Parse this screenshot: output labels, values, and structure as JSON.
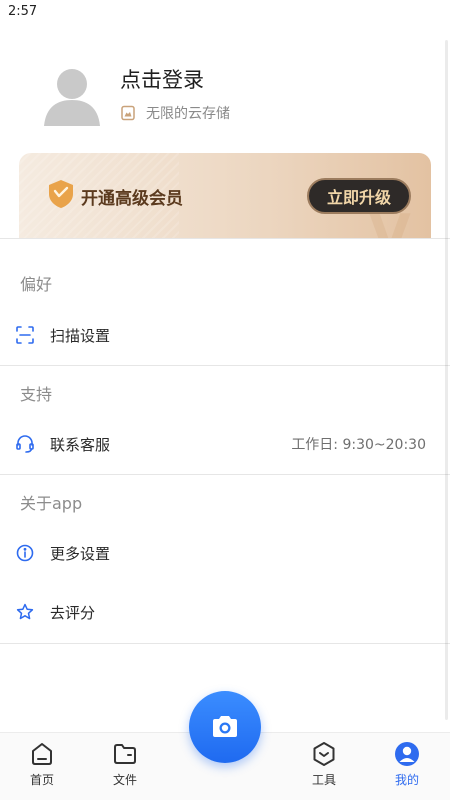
{
  "status_bar": {
    "time": "2:57"
  },
  "profile": {
    "login_title": "点击登录",
    "storage_text": "无限的云存储",
    "avatar_icon": "default-avatar-icon",
    "storage_icon": "cloud-drive-icon"
  },
  "vip": {
    "title": "开通高级会员",
    "button_label": "立即升级",
    "badge_icon": "crown-shield-icon"
  },
  "sections": {
    "preferences": "偏好",
    "support": "支持",
    "about": "关于app"
  },
  "menu": {
    "scan_settings": {
      "label": "扫描设置",
      "icon": "scan-frame-icon"
    },
    "contact_service": {
      "label": "联系客服",
      "extra": "工作日: 9:30~20:30",
      "icon": "headset-icon"
    },
    "more_settings": {
      "label": "更多设置",
      "icon": "info-circle-icon"
    },
    "rate": {
      "label": "去评分",
      "icon": "star-outline-icon"
    }
  },
  "tab_bar": {
    "home": "首页",
    "files": "文件",
    "tools": "工具",
    "mine": "我的",
    "active": "mine",
    "camera_icon": "camera-icon"
  },
  "colors": {
    "accent": "#2e6bef",
    "vip_text": "#5b3a1e",
    "vip_button_bg": "#2e2a28",
    "vip_button_text": "#f1d6a8"
  }
}
